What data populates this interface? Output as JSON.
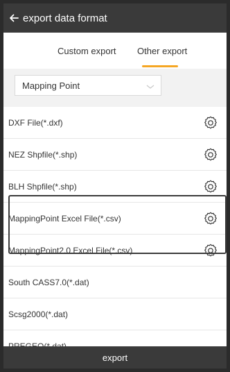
{
  "header": {
    "title": "export data format",
    "back_icon": "arrow-left-icon"
  },
  "tabs": [
    {
      "label": "Custom export",
      "active": false
    },
    {
      "label": "Other export",
      "active": true
    }
  ],
  "accent_color": "#f5a623",
  "dropdown": {
    "value": "Mapping Point",
    "icon": "chevron-down-icon"
  },
  "formats": [
    {
      "label": "DXF File(*.dxf)",
      "has_settings": true
    },
    {
      "label": "NEZ Shpfile(*.shp)",
      "has_settings": true
    },
    {
      "label": "BLH Shpfile(*.shp)",
      "has_settings": true
    },
    {
      "label": "MappingPoint Excel File(*.csv)",
      "has_settings": true,
      "highlighted": true
    },
    {
      "label": "MappingPoint2.0 Excel File(*.csv)",
      "has_settings": true,
      "highlighted": true
    },
    {
      "label": "South CASS7.0(*.dat)",
      "has_settings": false
    },
    {
      "label": "Scsg2000(*.dat)",
      "has_settings": false
    },
    {
      "label": "PREGEO(*.dat)",
      "has_settings": false
    }
  ],
  "footer": {
    "export_label": "export"
  }
}
